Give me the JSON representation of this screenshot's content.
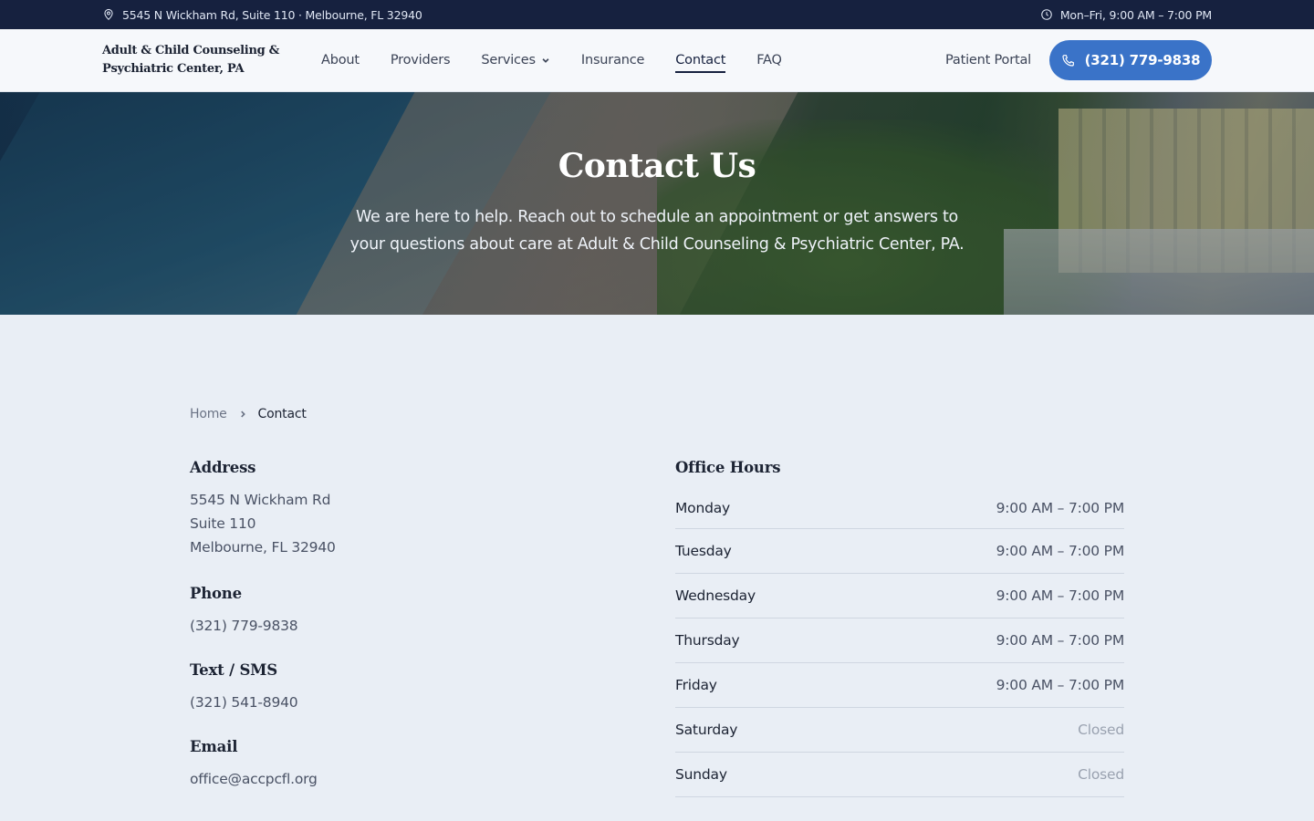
{
  "topbar": {
    "address": "5545 N Wickham Rd, Suite 110 · Melbourne, FL 32940",
    "hours": "Mon–Fri, 9:00 AM – 7:00 PM"
  },
  "header": {
    "logo": "Adult & Child Counseling & Psychiatric Center, PA",
    "nav": [
      {
        "label": "About"
      },
      {
        "label": "Providers"
      },
      {
        "label": "Services"
      },
      {
        "label": "Insurance"
      },
      {
        "label": "Contact"
      },
      {
        "label": "FAQ"
      }
    ],
    "portal_label": "Patient Portal",
    "phone_button": "(321) 779-9838"
  },
  "hero": {
    "title": "Contact Us",
    "subtitle": "We are here to help. Reach out to schedule an appointment or get answers to your questions about care at Adult & Child Counseling & Psychiatric Center, PA."
  },
  "breadcrumb": {
    "home": "Home",
    "current": "Contact"
  },
  "contact": {
    "address_heading": "Address",
    "address_line1": "5545 N Wickham Rd",
    "address_line2": "Suite 110",
    "address_line3": "Melbourne, FL 32940",
    "phone_heading": "Phone",
    "phone": "(321) 779-9838",
    "text_heading": "Text / SMS",
    "text": "(321) 541-8940",
    "email_heading": "Email",
    "email": "office@accpcfl.org"
  },
  "office_hours": {
    "heading": "Office Hours",
    "days": [
      {
        "day": "Monday",
        "time": "9:00 AM – 7:00 PM"
      },
      {
        "day": "Tuesday",
        "time": "9:00 AM – 7:00 PM"
      },
      {
        "day": "Wednesday",
        "time": "9:00 AM – 7:00 PM"
      },
      {
        "day": "Thursday",
        "time": "9:00 AM – 7:00 PM"
      },
      {
        "day": "Friday",
        "time": "9:00 AM – 7:00 PM"
      },
      {
        "day": "Saturday",
        "time": "Closed"
      },
      {
        "day": "Sunday",
        "time": "Closed"
      }
    ]
  },
  "colors": {
    "topbar_bg": "#16213f",
    "accent": "#3a73c8"
  },
  "icons": {
    "address": "map-pin-icon",
    "hours": "clock-icon",
    "phone": "phone-icon",
    "dropdown": "chevron-down-icon",
    "breadcrumb_sep": "chevron-right-icon"
  }
}
